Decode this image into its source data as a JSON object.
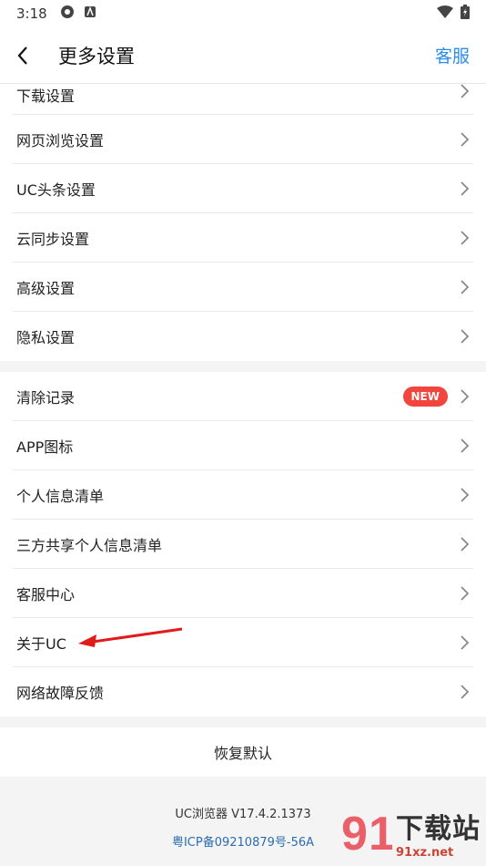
{
  "status_bar": {
    "time": "3:18"
  },
  "header": {
    "title": "更多设置",
    "service": "客服"
  },
  "group1": [
    {
      "label": "下载设置"
    },
    {
      "label": "网页浏览设置"
    },
    {
      "label": "UC头条设置"
    },
    {
      "label": "云同步设置"
    },
    {
      "label": "高级设置"
    },
    {
      "label": "隐私设置"
    }
  ],
  "group2": [
    {
      "label": "清除记录",
      "badge": "NEW"
    },
    {
      "label": "APP图标"
    },
    {
      "label": "个人信息清单"
    },
    {
      "label": "三方共享个人信息清单"
    },
    {
      "label": "客服中心"
    },
    {
      "label": "关于UC"
    },
    {
      "label": "网络故障反馈"
    }
  ],
  "restore": {
    "label": "恢复默认"
  },
  "footer": {
    "version": "UC浏览器 V17.4.2.1373",
    "icp": "粤ICP备09210879号-56A"
  },
  "watermark": {
    "logo": "91",
    "big": "下载站",
    "small": "91xz.net"
  },
  "colors": {
    "accent": "#2b8de6",
    "badge": "#f2453d",
    "arrow": "#e11b1b"
  }
}
